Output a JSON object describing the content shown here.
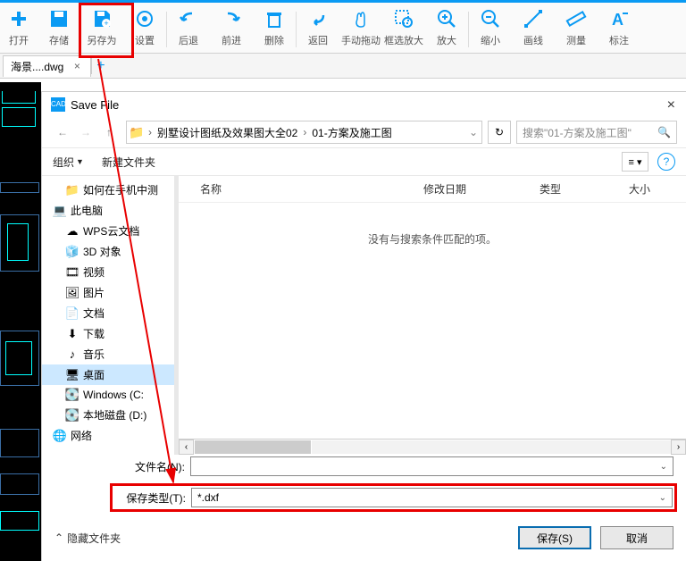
{
  "toolbar": [
    {
      "name": "open",
      "label": "打开"
    },
    {
      "name": "save",
      "label": "存储"
    },
    {
      "name": "saveas",
      "label": "另存为"
    },
    {
      "name": "settings",
      "label": "设置"
    },
    {
      "name": "undo",
      "label": "后退"
    },
    {
      "name": "redo",
      "label": "前进"
    },
    {
      "name": "delete",
      "label": "删除"
    },
    {
      "name": "return",
      "label": "返回"
    },
    {
      "name": "pan",
      "label": "手动拖动"
    },
    {
      "name": "zoomwin",
      "label": "框选放大"
    },
    {
      "name": "zoomin",
      "label": "放大"
    },
    {
      "name": "zoomout",
      "label": "缩小"
    },
    {
      "name": "line",
      "label": "画线"
    },
    {
      "name": "measure",
      "label": "测量"
    },
    {
      "name": "annot",
      "label": "标注"
    }
  ],
  "tab": {
    "label": "海景....dwg"
  },
  "dialog": {
    "title": "Save File",
    "breadcrumb": [
      "别墅设计图纸及效果图大全02",
      "01-方案及施工图"
    ],
    "search_placeholder": "搜索\"01-方案及施工图\"",
    "organize": "组织",
    "new_folder": "新建文件夹",
    "cols": {
      "name": "名称",
      "mod": "修改日期",
      "type": "类型",
      "size": "大小"
    },
    "empty": "没有与搜索条件匹配的项。",
    "tree": [
      {
        "label": "如何在手机中测",
        "icon": "folder",
        "lvl": 2
      },
      {
        "label": "此电脑",
        "icon": "pc",
        "lvl": 1
      },
      {
        "label": "WPS云文档",
        "icon": "cloud",
        "lvl": 2
      },
      {
        "label": "3D 对象",
        "icon": "3d",
        "lvl": 2
      },
      {
        "label": "视频",
        "icon": "video",
        "lvl": 2
      },
      {
        "label": "图片",
        "icon": "pic",
        "lvl": 2
      },
      {
        "label": "文档",
        "icon": "doc",
        "lvl": 2
      },
      {
        "label": "下载",
        "icon": "dl",
        "lvl": 2
      },
      {
        "label": "音乐",
        "icon": "music",
        "lvl": 2
      },
      {
        "label": "桌面",
        "icon": "desktop",
        "lvl": 2,
        "sel": true
      },
      {
        "label": "Windows (C:",
        "icon": "disk",
        "lvl": 2
      },
      {
        "label": "本地磁盘 (D:)",
        "icon": "disk",
        "lvl": 2
      },
      {
        "label": "网络",
        "icon": "net",
        "lvl": 1
      }
    ],
    "filename_label": "文件名(N):",
    "filename": "",
    "filetype_label": "保存类型(T):",
    "filetype": "*.dxf",
    "hide_folders": "隐藏文件夹",
    "save_btn": "保存(S)",
    "cancel_btn": "取消"
  }
}
